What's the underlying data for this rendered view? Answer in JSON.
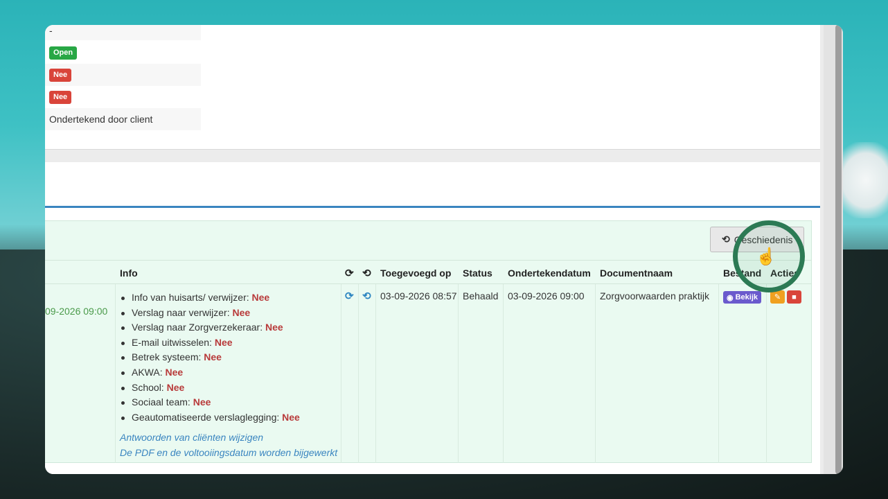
{
  "details": {
    "dash": "-",
    "badge_open": "Open",
    "badge_nee_1": "Nee",
    "badge_nee_2": "Nee",
    "signed_text": "Ondertekend door client"
  },
  "toolbar": {
    "history_label": "Geschiedenis"
  },
  "table": {
    "headers": {
      "info": "Info",
      "added": "Toegevoegd op",
      "status": "Status",
      "signed_date": "Ondertekendatum",
      "doc_name": "Documentnaam",
      "file": "Bestand",
      "actions": "Acties"
    },
    "row": {
      "left_date": "09-2026 09:00",
      "info_items": [
        {
          "label": "Info van huisarts/ verwijzer:",
          "value": "Nee"
        },
        {
          "label": "Verslag naar verwijzer:",
          "value": "Nee"
        },
        {
          "label": "Verslag naar Zorgverzekeraar:",
          "value": "Nee"
        },
        {
          "label": "E-mail uitwisselen:",
          "value": "Nee"
        },
        {
          "label": "Betrek systeem:",
          "value": "Nee"
        },
        {
          "label": "AKWA:",
          "value": "Nee"
        },
        {
          "label": "School:",
          "value": "Nee"
        },
        {
          "label": "Sociaal team:",
          "value": "Nee"
        },
        {
          "label": "Geautomatiseerde verslaglegging:",
          "value": "Nee"
        }
      ],
      "link_edit": "Antwoorden van cliënten wijzigen",
      "link_pdf": "De PDF en de voltooiingsdatum worden bijgewerkt",
      "added": "03-09-2026 08:57",
      "status": "Behaald",
      "signed_date": "03-09-2026 09:00",
      "doc_name": "Zorgvoorwaarden praktijk",
      "view_label": "Bekijk"
    }
  }
}
